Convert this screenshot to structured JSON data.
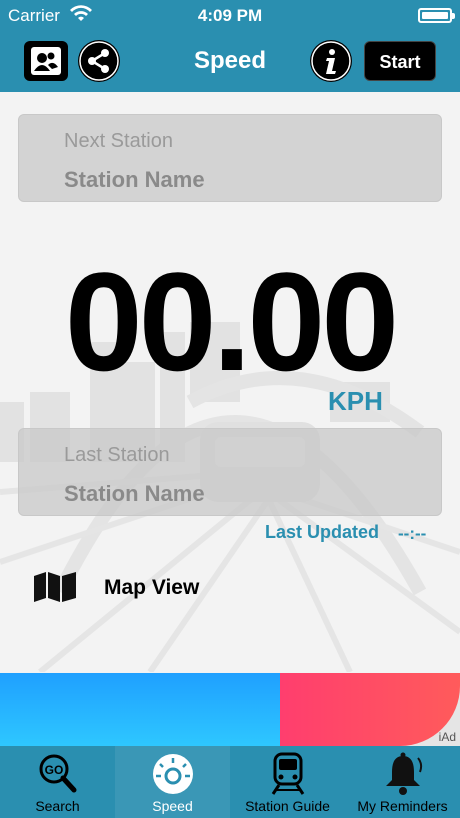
{
  "status_bar": {
    "carrier": "Carrier",
    "time": "4:09 PM"
  },
  "nav": {
    "title": "Speed",
    "start_label": "Start",
    "left_icons": [
      "people-icon",
      "share-icon"
    ],
    "right_icons": [
      "info-icon"
    ]
  },
  "next_station": {
    "label": "Next Station",
    "value": "Station Name"
  },
  "speed": {
    "value": "00.00",
    "unit": "KPH"
  },
  "last_station": {
    "label": "Last Station",
    "value": "Station Name"
  },
  "last_updated": {
    "label": "Last Updated",
    "value": "--:--"
  },
  "map_view": {
    "label": "Map View",
    "icon": "map-icon"
  },
  "ad": {
    "badge": "iAd"
  },
  "tabs": [
    {
      "label": "Search",
      "icon": "search-go-icon"
    },
    {
      "label": "Speed",
      "icon": "speedometer-icon"
    },
    {
      "label": "Station Guide",
      "icon": "train-icon"
    },
    {
      "label": "My Reminders",
      "icon": "bell-icon"
    }
  ],
  "colors": {
    "accent": "#2a8fb0",
    "ad_blue": "#1fa0ff",
    "ad_red": "#ff4a66"
  }
}
